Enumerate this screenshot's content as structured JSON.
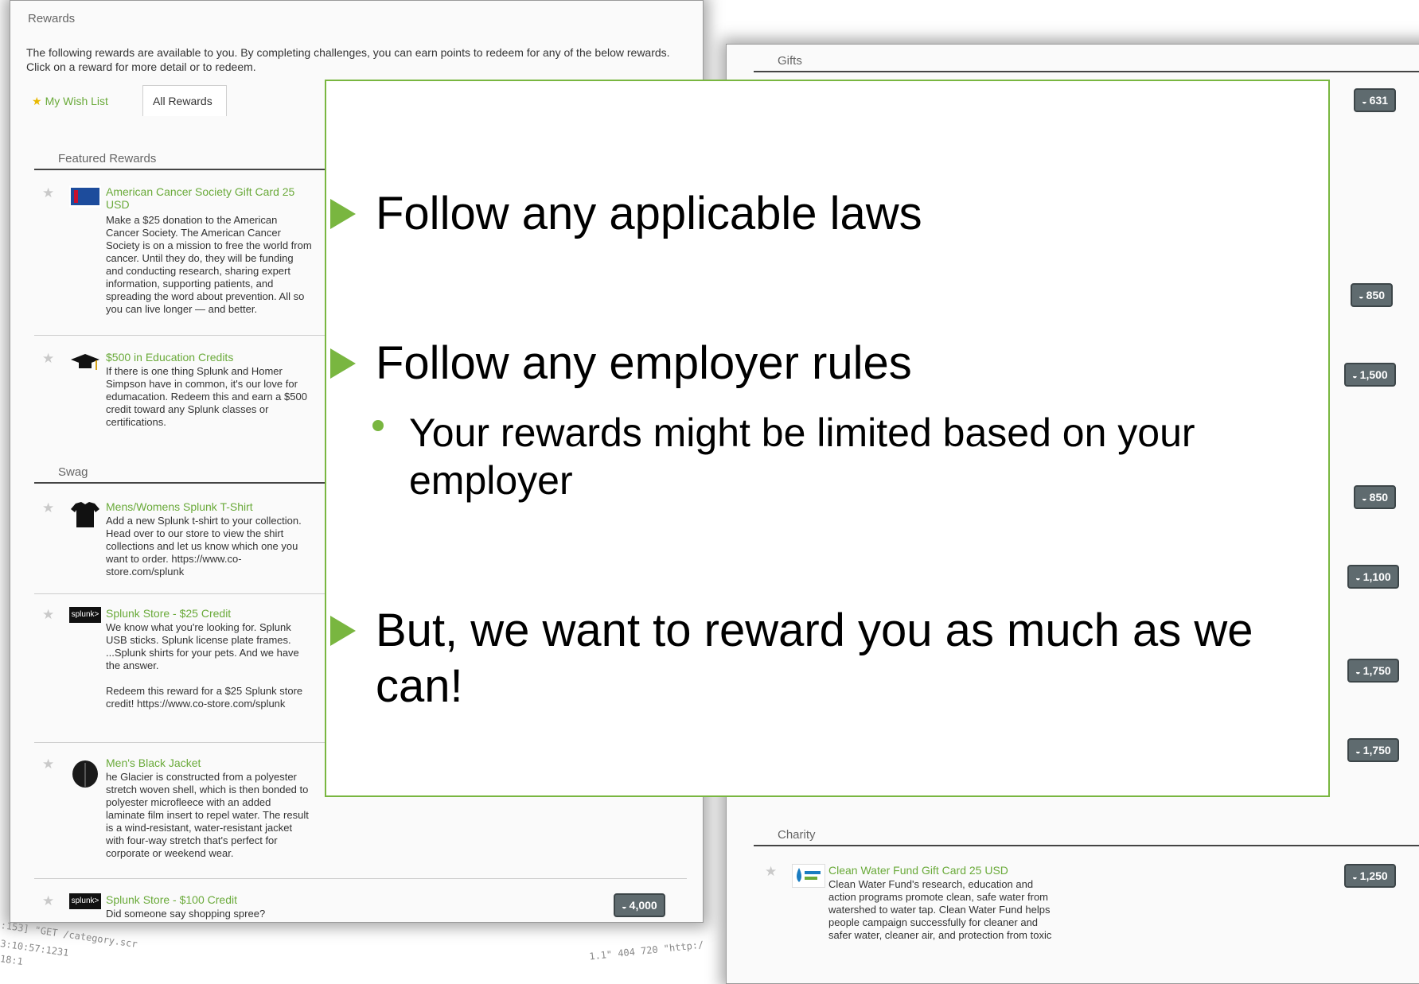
{
  "left": {
    "title": "Rewards",
    "intro": "The following rewards are available to you. By completing challenges, you can earn points to redeem for any of the below rewards. Click on a reward for more detail or to redeem.",
    "tabs": {
      "wish": "My Wish List",
      "all": "All Rewards"
    },
    "featured": {
      "heading": "Featured Rewards",
      "items": [
        {
          "title": "American Cancer Society Gift Card 25 USD",
          "desc": "Make a $25 donation to the American Cancer Society. The American Cancer Society is on a mission to free the world from cancer. Until they do, they will be funding and conducting research, sharing expert information, supporting patients, and spreading the word about prevention. All so you can live longer — and better.",
          "icon": "american-cancer-society-logo"
        },
        {
          "title": "$500 in Education Credits",
          "desc": "If there is one thing Splunk and Homer Simpson have in common, it's our love for edumacation. Redeem this and earn a $500 credit toward any Splunk classes or certifications.",
          "icon": "graduation-cap-icon"
        }
      ]
    },
    "swag": {
      "heading": "Swag",
      "items": [
        {
          "title": "Mens/Womens Splunk T-Shirt",
          "desc": "Add a new Splunk t-shirt to your collection. Head over to our store to view the shirt collections and let us know which one you want to order. https://www.co-store.com/splunk",
          "icon": "tshirt-icon"
        },
        {
          "title": "Splunk Store - $25 Credit",
          "desc": "We know what you're looking for. Splunk USB sticks. Splunk license plate frames. ...Splunk shirts for your pets. And we have the answer.",
          "desc2": "Redeem this reward for a $25 Splunk store credit! https://www.co-store.com/splunk",
          "icon": "splunk-logo",
          "logo_text": "splunk>"
        },
        {
          "title": "Men's Black Jacket",
          "desc": "he Glacier is constructed from a polyester stretch woven shell, which is then bonded to polyester microfleece with an added laminate film insert to repel water. The result is a wind-resistant, water-resistant jacket with four-way stretch that's perfect for corporate or weekend wear.",
          "icon": "jacket-icon"
        },
        {
          "title": "Splunk Store - $100 Credit",
          "desc": "Did someone say shopping spree?",
          "icon": "splunk-logo",
          "logo_text": "splunk>",
          "points": "4,000"
        }
      ]
    },
    "log_lines": [
      ":153] \"GET /category.scr",
      "3:10:57:1231",
      "18:1"
    ],
    "log_right": "1.1\" 404 720 \"http:/"
  },
  "right": {
    "title": "Gifts",
    "points": [
      "631",
      "850",
      "1,500",
      "850",
      "1,100",
      "1,750",
      "1,750"
    ],
    "charity": {
      "heading": "Charity",
      "item": {
        "title": "Clean Water Fund Gift Card 25 USD",
        "desc": "Clean Water Fund's research, education and action programs promote clean, safe water from watershed to water tap. Clean Water Fund helps people campaign successfully for cleaner and safer water, cleaner air, and protection from toxic",
        "icon": "clean-water-fund-logo",
        "points": "1,250"
      }
    }
  },
  "overlay": {
    "bullets": [
      {
        "text": "Follow any applicable laws"
      },
      {
        "text": "Follow any employer rules",
        "sub": "Your rewards might be limited based on your employer"
      },
      {
        "text": "But, we want to reward you as much as we can!"
      }
    ],
    "accent": "#79b640"
  }
}
